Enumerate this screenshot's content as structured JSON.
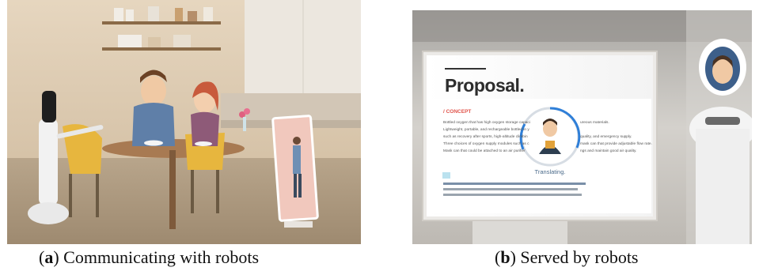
{
  "figure": {
    "panel_a": {
      "letter": "a",
      "caption_text": " Communicating with robots"
    },
    "panel_b": {
      "letter": "b",
      "caption_text": " Served by robots"
    }
  },
  "slide": {
    "title": "Proposal.",
    "concept": "/ CONCEPT",
    "lines": [
      "Bottled oxygen that has high oxygen storage capaci",
      "Lightweight, portable, and rechargeable bottled in y",
      "such as recovery after sports, high-altitude climbin",
      "Three choices of oxygen supply modules such as c",
      "Mask can that could be attached to an air purifier"
    ],
    "right_lines": [
      "ureous materials.",
      "quality, and emergency supply.",
      "mask can that provide adjustable flow rate.",
      "ngs and maintain good air quality."
    ],
    "status": "Translating."
  }
}
